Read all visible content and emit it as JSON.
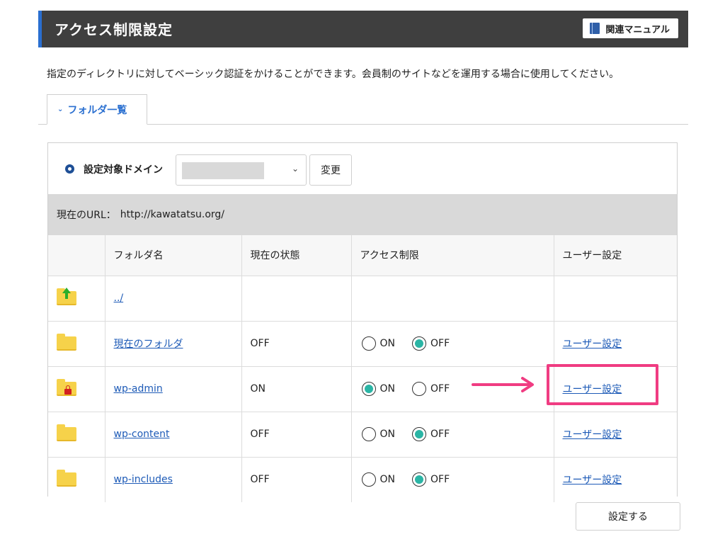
{
  "header": {
    "title": "アクセス制限設定",
    "manual_label": "関連マニュアル",
    "manual_icon": "book-icon"
  },
  "description": "指定のディレクトリに対してベーシック認証をかけることができます。会員制のサイトなどを運用する場合に使用してください。",
  "tab": {
    "label": "フォルダ一覧",
    "icon": "chevron-down-icon"
  },
  "domain": {
    "label": "設定対象ドメイン",
    "selected": "",
    "change_label": "変更"
  },
  "url": {
    "label": "現在のURL：",
    "value": "http://kawatatsu.org/"
  },
  "table": {
    "headers": [
      "フォルダ名",
      "現在の状態",
      "アクセス制限",
      "ユーザー設定"
    ],
    "on_label": "ON",
    "off_label": "OFF",
    "user_link": "ユーザー設定",
    "rows": [
      {
        "name": "../",
        "icon": "folder-up-icon"
      },
      {
        "name": "現在のフォルダ",
        "state": "OFF",
        "access": "OFF",
        "icon": "folder-icon"
      },
      {
        "name": "wp-admin",
        "state": "ON",
        "access": "ON",
        "icon": "folder-locked-icon"
      },
      {
        "name": "wp-content",
        "state": "OFF",
        "access": "OFF",
        "icon": "folder-icon"
      },
      {
        "name": "wp-includes",
        "state": "OFF",
        "access": "OFF",
        "icon": "folder-icon"
      }
    ]
  },
  "submit_label": "設定する",
  "colors": {
    "accent": "#2a6fd0",
    "radio_checked": "#2bb5a5",
    "annotation": "#f03c82",
    "header_bg": "#3f3f3f"
  }
}
